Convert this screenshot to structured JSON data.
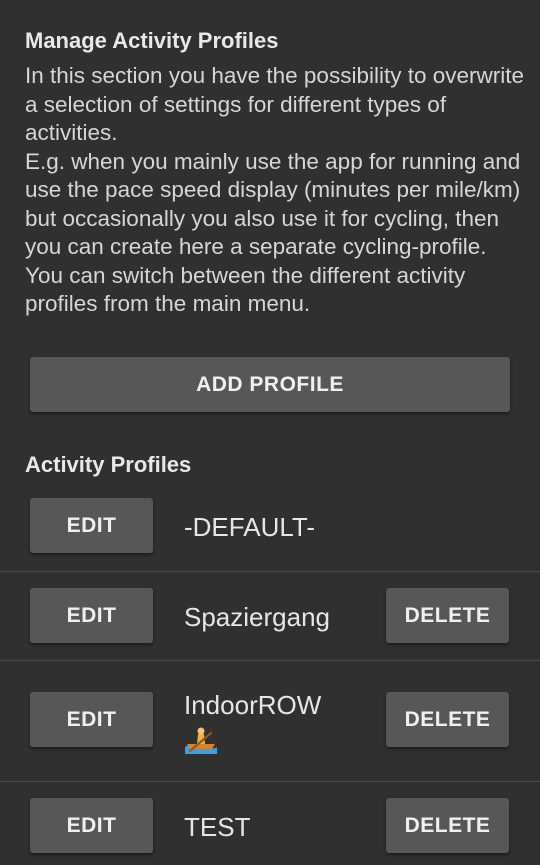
{
  "manage": {
    "title": "Manage Activity Profiles",
    "paragraphs": [
      "In this section you have the possibility to overwrite a selection of settings for different types of activities.",
      "E.g. when you mainly use the app for running and use the pace speed display (minutes per mile/km) but occasionally you also use it for cycling, then you can create here a separate cycling-profile.",
      "You can switch between the different activity profiles from the main menu."
    ],
    "add_button_label": "ADD PROFILE"
  },
  "profiles": {
    "title": "Activity Profiles",
    "edit_label": "EDIT",
    "delete_label": "DELETE",
    "items": [
      {
        "name": "-DEFAULT-",
        "deletable": false
      },
      {
        "name": "Spaziergang",
        "deletable": true
      },
      {
        "name": "IndoorROW",
        "icon": "rowing-boat-emoji",
        "deletable": true
      },
      {
        "name": "TEST",
        "deletable": true
      }
    ]
  },
  "colors": {
    "background": "#303030",
    "button": "#575757",
    "divider": "#4a4a4a",
    "text": "#e6e6e6"
  }
}
